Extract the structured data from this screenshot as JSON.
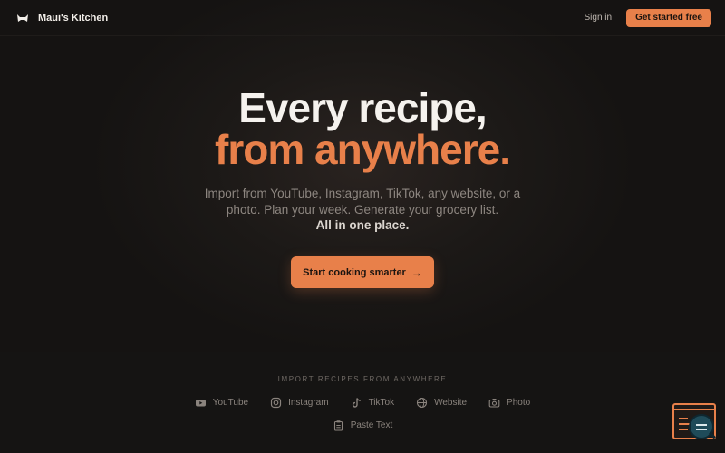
{
  "nav": {
    "brand": "Maui's Kitchen",
    "logo_icon": "cat-logo-icon",
    "signin": "Sign in",
    "cta": "Get started free"
  },
  "hero": {
    "headline_line1": "Every recipe,",
    "headline_line2": "from anywhere.",
    "subtitle": "Import from YouTube, Instagram, TikTok, any website, or a photo. Plan your week. Generate your grocery list.",
    "subtitle_strong": "All in one place.",
    "cta": "Start cooking smarter",
    "cta_icon": "arrow-right-icon"
  },
  "imports": {
    "label": "IMPORT RECIPES FROM ANYWHERE",
    "sources": [
      {
        "label": "YouTube",
        "icon": "youtube-icon"
      },
      {
        "label": "Instagram",
        "icon": "instagram-icon"
      },
      {
        "label": "TikTok",
        "icon": "tiktok-icon"
      },
      {
        "label": "Website",
        "icon": "globe-icon"
      },
      {
        "label": "Photo",
        "icon": "camera-icon"
      },
      {
        "label": "Paste Text",
        "icon": "clipboard-icon"
      }
    ]
  },
  "colors": {
    "accent": "#e8804a",
    "background": "#121110",
    "headline": "#f5f2ee",
    "muted": "#8a837d"
  }
}
